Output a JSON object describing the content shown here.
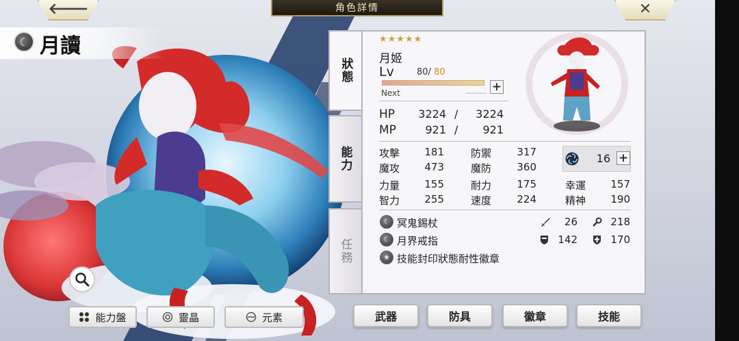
{
  "header": {
    "title": "角色詳情",
    "back_icon": "back-arrow-icon",
    "close_icon": "close-x-icon"
  },
  "character": {
    "name": "月讀",
    "element_icon": "moon-icon"
  },
  "left_buttons": {
    "zoom_icon": "magnifier-icon",
    "ability_board": "能力盤",
    "spirit_crystal": "靈晶",
    "element": "元素"
  },
  "tabs": [
    {
      "label": "狀態",
      "active": true
    },
    {
      "label": "能力",
      "active": false
    },
    {
      "label": "任務",
      "active": false
    }
  ],
  "status": {
    "stars": "★★★★★",
    "alias": "月姬",
    "lv_label": "Lv",
    "lv_current": "80",
    "lv_sep": "/",
    "lv_max": "80",
    "exp_fraction": 1.0,
    "next_label": "Next",
    "next_value": "--------",
    "hp_label": "HP",
    "hp_current": "3224",
    "hp_max": "3224",
    "mp_label": "MP",
    "mp_current": "921",
    "mp_max": "921",
    "slash": "/"
  },
  "stats": {
    "attack_label": "攻擊",
    "attack": "181",
    "defense_label": "防禦",
    "defense": "317",
    "magic_attack_label": "魔攻",
    "magic_attack": "473",
    "magic_defense_label": "魔防",
    "magic_defense": "360",
    "strength_label": "力量",
    "strength": "155",
    "endurance_label": "耐力",
    "endurance": "175",
    "luck_label": "幸運",
    "luck": "157",
    "intelligence_label": "智力",
    "intelligence": "255",
    "speed_label": "速度",
    "speed": "224",
    "spirit_label": "精神",
    "spirit": "190",
    "element_value": "16"
  },
  "equipment": [
    {
      "name": "冥鬼錫杖",
      "stat1_icon": "sword-icon",
      "stat1": "26",
      "stat2_icon": "wand-icon",
      "stat2": "218"
    },
    {
      "name": "月界戒指",
      "stat1_icon": "shield-icon",
      "stat1": "142",
      "stat2_icon": "cross-shield-icon",
      "stat2": "170"
    },
    {
      "name": "技能封印狀態耐性徽章"
    }
  ],
  "bottom_buttons": {
    "weapon": "武器",
    "armor": "防具",
    "badge": "徽章",
    "skill": "技能"
  },
  "colors": {
    "accent_gold": "#c9a03c",
    "level_max": "#d08a1e",
    "panel_bg": "#f8f7fa"
  }
}
